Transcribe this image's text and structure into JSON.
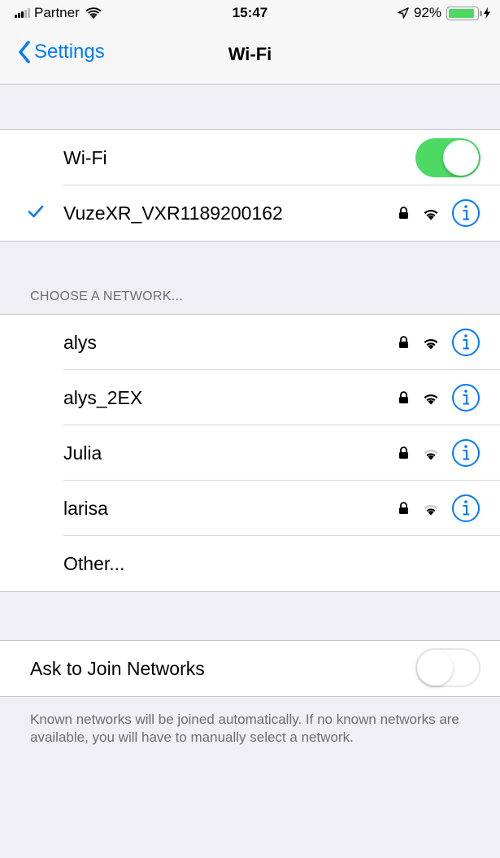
{
  "status_bar": {
    "carrier": "Partner",
    "time": "15:47",
    "battery_percent": "92%",
    "battery_level": 0.92
  },
  "nav": {
    "back_label": "Settings",
    "title": "Wi-Fi"
  },
  "wifi_section": {
    "label": "Wi-Fi",
    "enabled": true,
    "connected_network": "VuzeXR_VXR1189200162"
  },
  "networks_section": {
    "header": "CHOOSE A NETWORK...",
    "networks": [
      {
        "name": "alys",
        "secured": true,
        "signal": 3
      },
      {
        "name": "alys_2EX",
        "secured": true,
        "signal": 3
      },
      {
        "name": "Julia",
        "secured": true,
        "signal": 2
      },
      {
        "name": "larisa",
        "secured": true,
        "signal": 2
      }
    ],
    "other_label": "Other..."
  },
  "ask_join": {
    "label": "Ask to Join Networks",
    "enabled": false,
    "note": "Known networks will be joined automatically. If no known networks are available, you will have to manually select a network."
  },
  "colors": {
    "accent": "#007aff",
    "toggle_on": "#4cd964",
    "background": "#efeff4",
    "secondary_text": "#6d6d72"
  }
}
